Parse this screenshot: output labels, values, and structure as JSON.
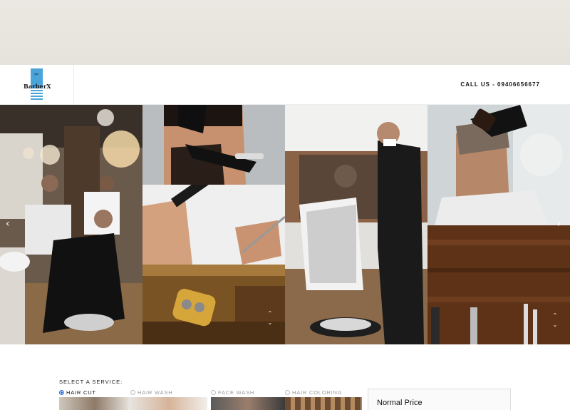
{
  "header": {
    "brand": "BarberX",
    "call_label": "CALL US - 09406656677"
  },
  "gallery": {
    "prev_arrow": "‹",
    "next_arrow": "›",
    "up_glyph": "⌃",
    "down_glyph": "⌄",
    "icons": [
      "chevron-left-icon",
      "chevron-right-icon",
      "chevron-up-icon",
      "chevron-down-icon"
    ]
  },
  "services": {
    "title": "SELECT A SERVICE:",
    "options": [
      {
        "label": "HAIR CUT",
        "selected": true
      },
      {
        "label": "HAIR WASH",
        "selected": false
      },
      {
        "label": "FACE WASH",
        "selected": false
      },
      {
        "label": "HAIR COLORING",
        "selected": false
      }
    ],
    "price_label": "Normal Price"
  },
  "colors": {
    "brand_blue": "#4aa3d9",
    "radio_selected": "#1a66d6",
    "top_band": "#e9e6e0"
  }
}
